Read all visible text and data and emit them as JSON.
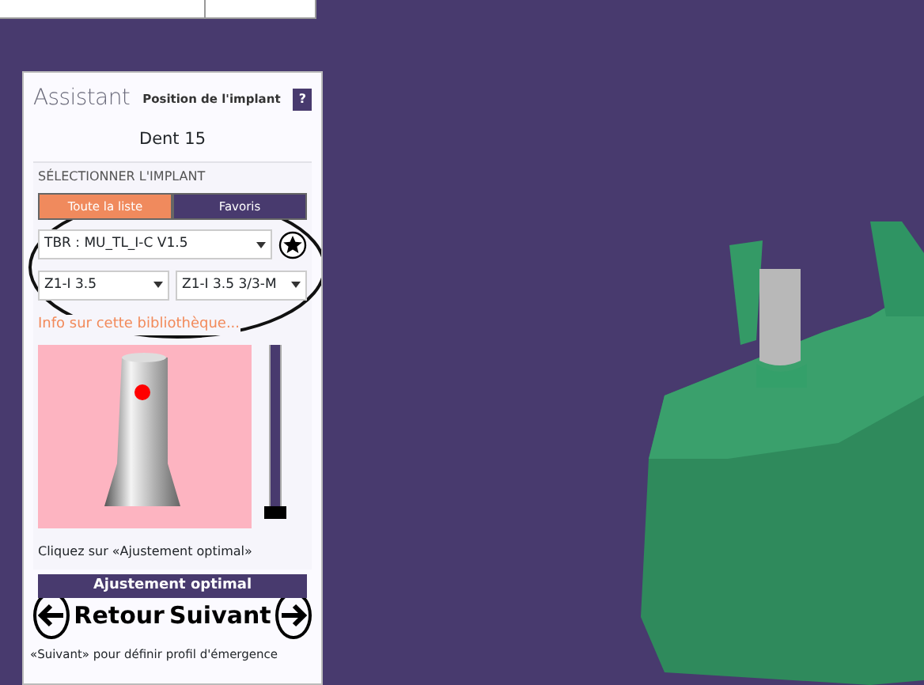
{
  "assistant": {
    "title": "Assistant",
    "subtitle": "Position de l'implant",
    "help": "?"
  },
  "tooth": "Dent 15",
  "section": {
    "heading": "SÉLECTIONNER L'IMPLANT",
    "tabs": [
      {
        "label": "Toute la liste",
        "selected": true
      },
      {
        "label": "Favoris",
        "selected": false
      }
    ],
    "library": "TBR : MU_TL_I-C V1.5",
    "favorite": false,
    "selects": [
      "Z1-I 3.5",
      "Z1-I 3.5  3/3-M"
    ],
    "info_link": "Info sur cette bibliothèque...",
    "depth_slider": {
      "level": 0
    },
    "hint": "Cliquez sur «Ajustement optimal»",
    "action": "Ajustement optimal"
  },
  "nav": {
    "back": "Retour",
    "next": "Suivant"
  },
  "footer": "«Suivant» pour définir profil d'émergence"
}
